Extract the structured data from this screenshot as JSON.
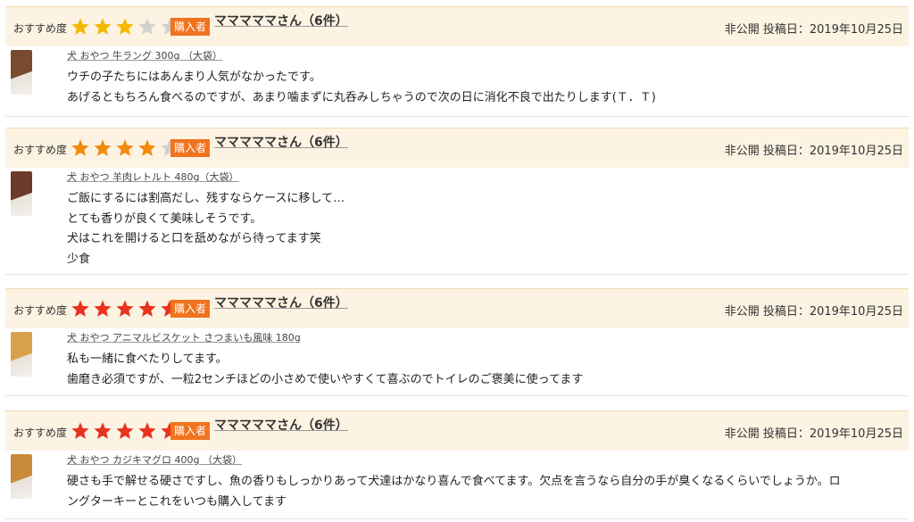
{
  "reviews": [
    {
      "rec_label": "おすすめ度",
      "rating": 3,
      "badge": "購入者",
      "user": "マママママさん（6件）",
      "meta": "非公開 投稿日：2019年10月25日",
      "product": "犬 おやつ 牛ラング 300g （大袋）",
      "lines": [
        "ウチの子たちにはあんまり人気がなかったです。",
        "あげるともちろん食べるのですが、あまり噛まずに丸呑みしちゃうので次の日に消化不良で出たりします(Ｔ．Ｔ)"
      ]
    },
    {
      "rec_label": "おすすめ度",
      "rating": 4,
      "badge": "購入者",
      "user": "マママママさん（6件）",
      "meta": "非公開 投稿日：2019年10月25日",
      "product": "犬 おやつ 羊肉レトルト 480g（大袋）",
      "lines": [
        "ご飯にするには割高だし、残すならケースに移して…",
        "とても香りが良くて美味しそうです。",
        "犬はこれを開けると口を舐めながら待ってます笑",
        "少食"
      ]
    },
    {
      "rec_label": "おすすめ度",
      "rating": 5,
      "badge": "購入者",
      "user": "マママママさん（6件）",
      "meta": "非公開 投稿日：2019年10月25日",
      "product": "犬 おやつ アニマルビスケット さつまいも風味 180g",
      "lines": [
        "私も一緒に食べたりしてます。",
        "歯磨き必須ですが、一粒2センチほどの小さめで使いやすくて喜ぶのでトイレのご褒美に使ってます"
      ]
    },
    {
      "rec_label": "おすすめ度",
      "rating": 5,
      "badge": "購入者",
      "user": "マママママさん（6件）",
      "meta": "非公開 投稿日：2019年10月25日",
      "product": "犬 おやつ カジキマグロ 400g （大袋）",
      "lines": [
        "硬さも手で解せる硬さですし、魚の香りもしっかりあって犬達はかなり喜んで食べてます。欠点を言うなら自分の手が臭くなるくらいでしょうか。ロ",
        "ングターキーとこれをいつも購入してます"
      ]
    }
  ],
  "colors": {
    "star_3": "#f5b800",
    "star_4": "#f28a0c",
    "star_5": "#e8331f",
    "star_empty": "#d0d0d0",
    "thumb_1": "#7a4a2e",
    "thumb_2": "#6b3a2a",
    "thumb_3": "#d9a24a",
    "thumb_4": "#c98a3a"
  }
}
